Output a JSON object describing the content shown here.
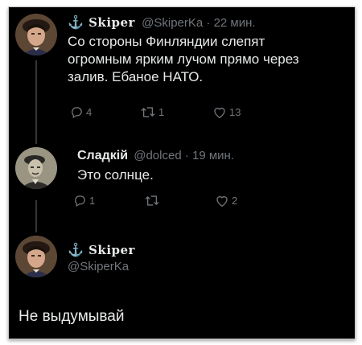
{
  "tweet1": {
    "display_name": "Skiper",
    "handle": "@SkiperKa",
    "separator": "·",
    "time": "22 мин.",
    "text_lines": [
      "Со стороны Финляндии слепят",
      "огромным ярким лучом прямо через",
      "залив. Ебаное НАТО."
    ],
    "replies": "4",
    "retweets": "1",
    "likes": "13"
  },
  "tweet2": {
    "display_name": "Сладкій",
    "handle": "@dolced",
    "separator": "·",
    "time": "19 мин.",
    "text": "Это солнце.",
    "replies": "1",
    "retweets": "",
    "likes": "2"
  },
  "tweet3": {
    "display_name": "Skiper",
    "handle": "@SkiperKa",
    "text": "Не выдумывай"
  },
  "colors": {
    "background": "#000000",
    "text": "#e7e9ea",
    "secondary": "#71767b",
    "thread_line": "#333639"
  },
  "icons": {
    "anchor": "⚓",
    "reply": "reply-icon",
    "retweet": "retweet-icon",
    "like": "heart-icon"
  }
}
